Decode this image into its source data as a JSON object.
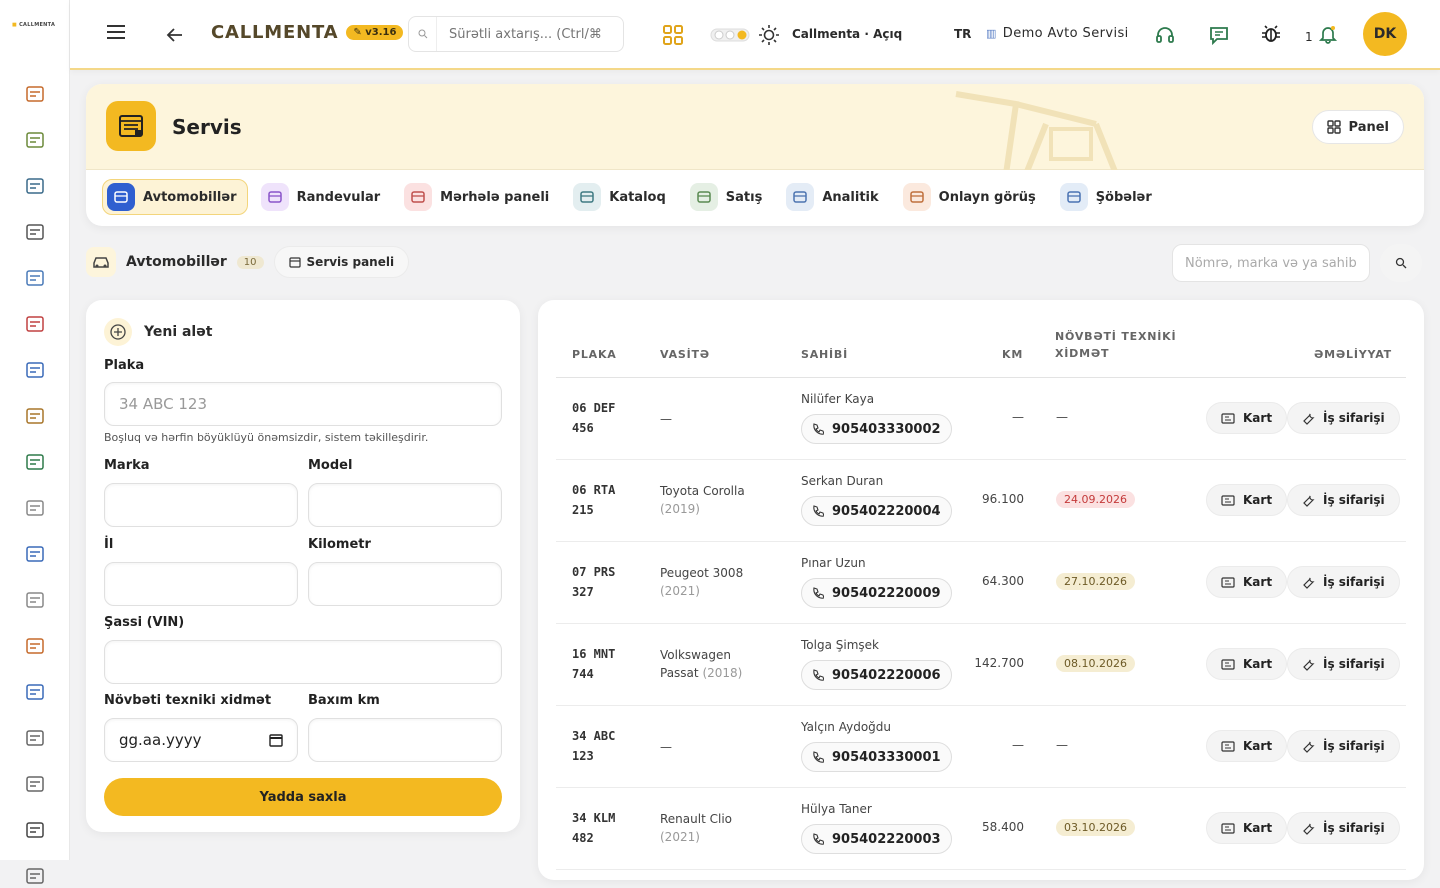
{
  "sidebar": {
    "logo": "CALLMENTA",
    "icons": [
      "calendar-grid-icon",
      "clipboard-icon",
      "id-card-icon",
      "ring-icon",
      "face-scan-icon",
      "alarm-icon",
      "chat-user-icon",
      "medal-icon",
      "megaphone-icon",
      "gear-icon",
      "calculator-icon",
      "shield-icon",
      "boxes-icon",
      "line-chart-icon",
      "globe-icon",
      "sliders-icon",
      "bar-chart-icon",
      "warning-icon"
    ]
  },
  "topbar": {
    "brand": "CALLMENTA",
    "version": "v3.16",
    "search_placeholder": "Sürətli axtarış... (Ctrl/⌘",
    "theme_label": "Callmenta · Açıq",
    "language": "TR",
    "company": "Demo Avto Servisi",
    "notification_count": "1",
    "avatar_initials": "DK"
  },
  "header": {
    "title": "Servis",
    "panel_button": "Panel",
    "tabs": [
      {
        "label": "Avtomobillər",
        "bg": "#2f5fd0",
        "fg": "#ffffff"
      },
      {
        "label": "Randevular",
        "bg": "#efe3fb",
        "fg": "#8a55c9"
      },
      {
        "label": "Mərhələ paneli",
        "bg": "#fbe1e1",
        "fg": "#c0504d"
      },
      {
        "label": "Kataloq",
        "bg": "#e3eef0",
        "fg": "#3f7a82"
      },
      {
        "label": "Satış",
        "bg": "#e5efe4",
        "fg": "#5a8a52"
      },
      {
        "label": "Analitik",
        "bg": "#e4ecf6",
        "fg": "#4d74b0"
      },
      {
        "label": "Onlayn görüş",
        "bg": "#fbe9de",
        "fg": "#c0703d"
      },
      {
        "label": "Şöbələr",
        "bg": "#e3ecf7",
        "fg": "#4a73b3"
      }
    ]
  },
  "subheader": {
    "title": "Avtomobillər",
    "count": "10",
    "service_panel": "Servis paneli",
    "search_placeholder": "Nömrə, marka və ya sahib"
  },
  "form": {
    "title": "Yeni alət",
    "plate_label": "Plaka",
    "plate_placeholder": "34 ABC 123",
    "plate_hint": "Boşluq və hərfin böyüklüyü önəmsizdir, sistem təkilleşdirir.",
    "brand_label": "Marka",
    "model_label": "Model",
    "year_label": "İl",
    "km_label": "Kilometr",
    "vin_label": "Şassi (VIN)",
    "next_service_label": "Növbəti texniki xidmət",
    "next_service_placeholder": "gg.aa.yyyy",
    "service_km_label": "Baxım km",
    "save_button": "Yadda saxla"
  },
  "table": {
    "columns": [
      "PLAKA",
      "VASİTƏ",
      "SAHİBİ",
      "KM",
      "NÖVBƏTİ TEXNİKİ XİDMƏT",
      "ƏMƏLİYYAT"
    ],
    "card_label": "Kart",
    "order_label": "İş sifarişi",
    "rows": [
      {
        "plate1": "06 DEF",
        "plate2": "456",
        "vehicle": "—",
        "year": "",
        "owner": "Nilüfer Kaya",
        "phone": "905403330002",
        "km": "—",
        "due": "—",
        "due_style": "none"
      },
      {
        "plate1": "06 RTA",
        "plate2": "215",
        "vehicle": "Toyota Corolla",
        "year": "(2019)",
        "owner": "Serkan Duran",
        "phone": "905402220004",
        "km": "96.100",
        "due": "24.09.2026",
        "due_style": "red"
      },
      {
        "plate1": "07 PRS",
        "plate2": "327",
        "vehicle": "Peugeot 3008",
        "year": "(2021)",
        "owner": "Pınar Uzun",
        "phone": "905402220009",
        "km": "64.300",
        "due": "27.10.2026",
        "due_style": "sand"
      },
      {
        "plate1": "16 MNT",
        "plate2": "744",
        "vehicle": "Volkswagen",
        "vehicle2": "Passat",
        "year": "(2018)",
        "owner": "Tolga Şimşek",
        "phone": "905402220006",
        "km": "142.700",
        "due": "08.10.2026",
        "due_style": "sand"
      },
      {
        "plate1": "34 ABC",
        "plate2": "123",
        "vehicle": "—",
        "year": "",
        "owner": "Yalçın Aydoğdu",
        "phone": "905403330001",
        "km": "—",
        "due": "—",
        "due_style": "none"
      },
      {
        "plate1": "34 KLM",
        "plate2": "482",
        "vehicle": "Renault Clio",
        "year": "(2021)",
        "owner": "Hülya Taner",
        "phone": "905402220003",
        "km": "58.400",
        "due": "03.10.2026",
        "due_style": "sand"
      }
    ]
  },
  "colors": {
    "accent": "#f3b921",
    "accent_soft": "#fdf5dc"
  }
}
